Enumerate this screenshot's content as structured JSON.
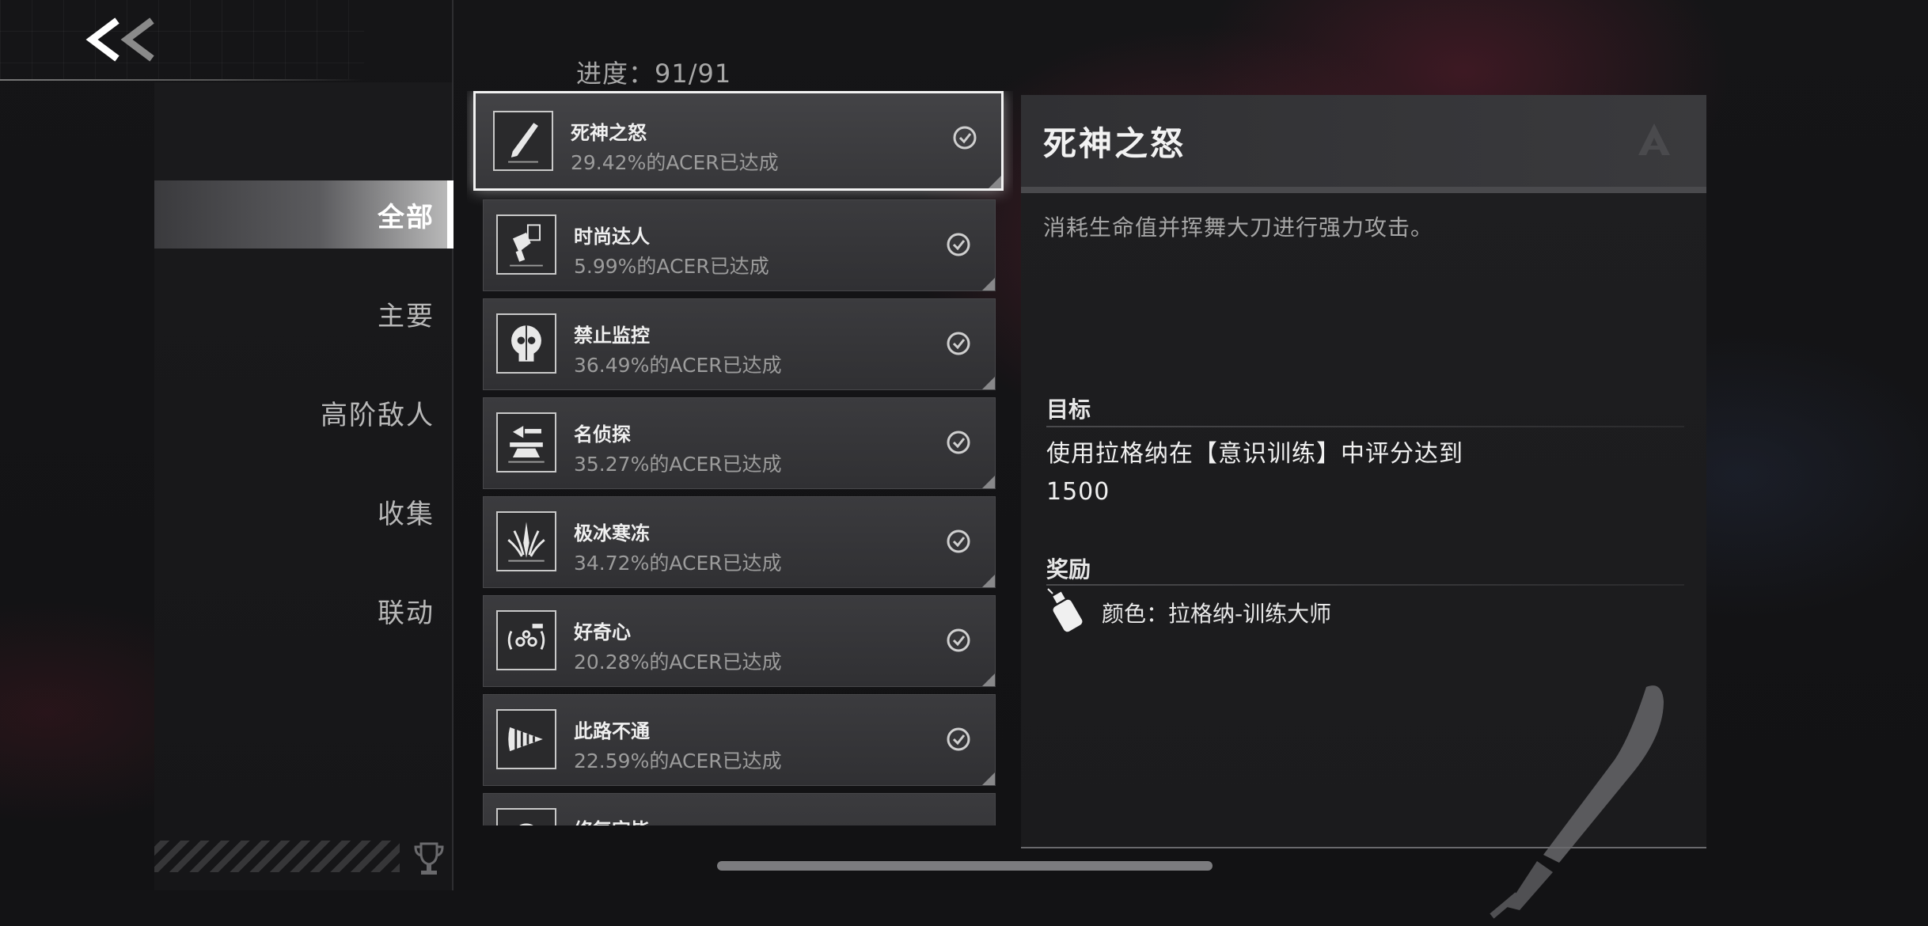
{
  "progress": {
    "text": "进度：91/91"
  },
  "sidebar": {
    "items": [
      {
        "label": "全部",
        "active": true
      },
      {
        "label": "主要"
      },
      {
        "label": "高阶敌人"
      },
      {
        "label": "收集"
      },
      {
        "label": "联动"
      }
    ]
  },
  "achievements": [
    {
      "title": "死神之怒",
      "rate": "29.42%的ACER已达成",
      "icon": "blade-icon",
      "selected": true
    },
    {
      "title": "时尚达人",
      "rate": "5.99%的ACER已达成",
      "icon": "paint-brush-icon"
    },
    {
      "title": "禁止监控",
      "rate": "36.49%的ACER已达成",
      "icon": "skull-icon"
    },
    {
      "title": "名侦探",
      "rate": "35.27%的ACER已达成",
      "icon": "detective-icon"
    },
    {
      "title": "极冰寒冻",
      "rate": "34.72%的ACER已达成",
      "icon": "ice-crystal-icon"
    },
    {
      "title": "好奇心",
      "rate": "20.28%的ACER已达成",
      "icon": "curiosity-icon"
    },
    {
      "title": "此路不通",
      "rate": "22.59%的ACER已达成",
      "icon": "drill-icon"
    },
    {
      "title": "修复完毕",
      "rate": "",
      "icon": "repair-icon"
    }
  ],
  "detail": {
    "title": "死神之怒",
    "description": "消耗生命值并挥舞大刀进行强力攻击。",
    "goal_heading": "目标",
    "goal_text": "使用拉格纳在【意识训练】中评分达到1500",
    "reward_heading": "奖励",
    "reward_text": "颜色：拉格纳-训练大师"
  },
  "colors": {
    "accent": "#ffffff",
    "panel": "#3a3a3d",
    "text_muted": "#9c9c9c"
  }
}
